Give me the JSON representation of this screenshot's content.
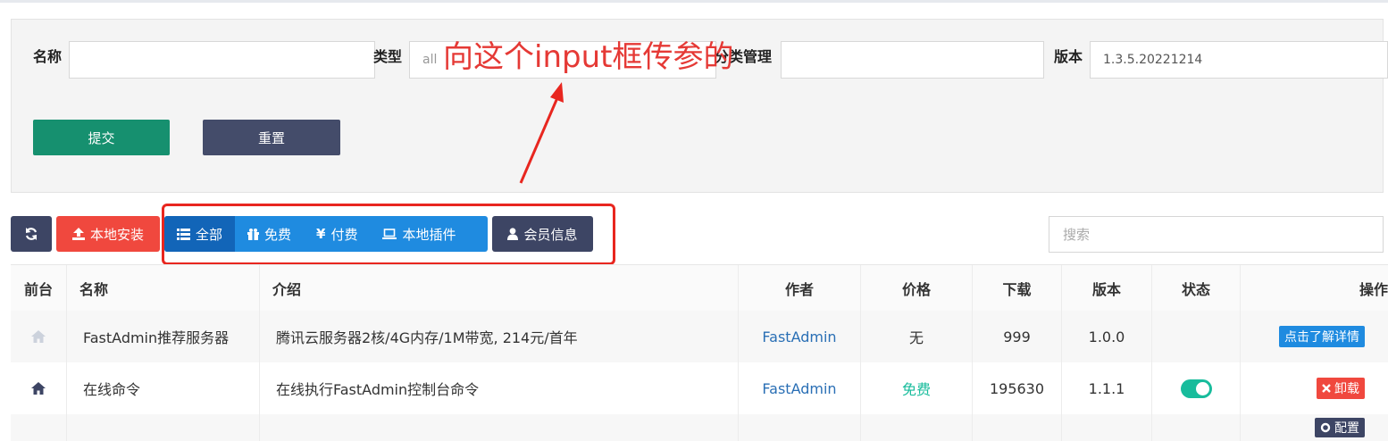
{
  "filters": {
    "name_label": "名称",
    "name_value": "",
    "type_label": "类型",
    "type_value": "all",
    "category_label": "分类管理",
    "category_value": "",
    "version_label": "版本",
    "version_value": "1.3.5.20221214",
    "submit_label": "提交",
    "reset_label": "重置"
  },
  "annotation": "向这个input框传参的",
  "toolbar": {
    "refresh_icon": "refresh-icon",
    "local_install_label": "本地安装",
    "tabs": [
      {
        "label": "全部",
        "icon": "list-icon",
        "active": true
      },
      {
        "label": "免费",
        "icon": "gift-icon",
        "active": false
      },
      {
        "label": "付费",
        "icon": "yen-icon",
        "active": false
      },
      {
        "label": "本地插件",
        "icon": "laptop-icon",
        "active": false
      }
    ],
    "member_label": "会员信息",
    "search_placeholder": "搜索"
  },
  "table": {
    "headers": [
      "前台",
      "名称",
      "介绍",
      "作者",
      "价格",
      "下载",
      "版本",
      "状态",
      "操作"
    ],
    "rows": [
      {
        "front_icon": "home-icon",
        "name": "FastAdmin推荐服务器",
        "intro": "腾讯云服务器2核/4G内存/1M带宽, 214元/首年",
        "author": "FastAdmin",
        "price": "无",
        "downloads": "999",
        "version": "1.0.0",
        "status": "",
        "action": "点击了解详情"
      },
      {
        "front_icon": "home-icon",
        "name": "在线命令",
        "intro": "在线执行FastAdmin控制台命令",
        "author": "FastAdmin",
        "price": "免费",
        "downloads": "195630",
        "version": "1.1.1",
        "status": "on",
        "action": "卸载"
      }
    ],
    "partial_row_action": "配置"
  },
  "colors": {
    "primary": "#1f8be0",
    "primary_active": "#1265b8",
    "success": "#16906f",
    "dark": "#3d4564",
    "danger": "#f0483e",
    "annotation_red": "#e8261f",
    "free_green": "#18bc9c"
  }
}
